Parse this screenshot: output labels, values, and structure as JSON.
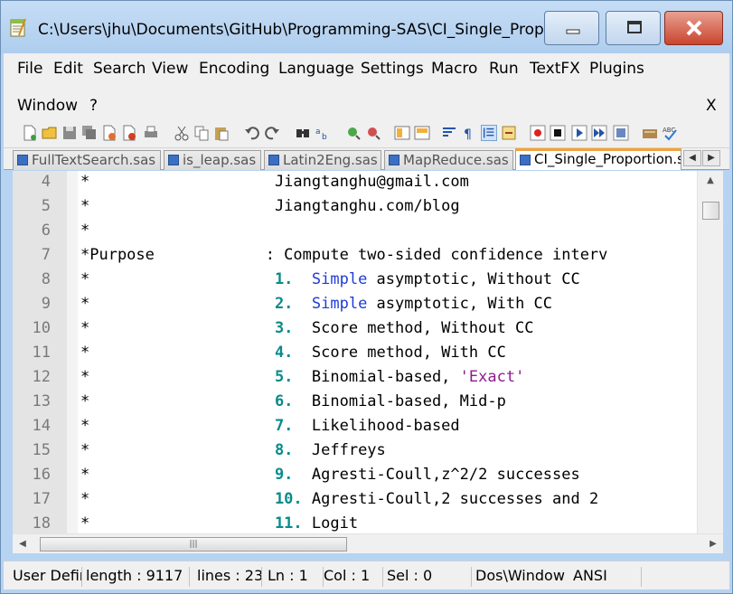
{
  "window": {
    "title": "C:\\Users\\jhu\\Documents\\GitHub\\Programming-SAS\\CI_Single_Prop..."
  },
  "menu": {
    "items": [
      "File",
      "Edit",
      "Search",
      "View",
      "Encoding",
      "Language",
      "Settings",
      "Macro",
      "Run",
      "TextFX",
      "Plugins"
    ],
    "row2": [
      "Window",
      "?"
    ],
    "close_doc": "X"
  },
  "toolbar": {
    "icons": [
      "new-file-icon",
      "open-file-icon",
      "save-icon",
      "save-all-icon",
      "close-icon",
      "close-all-icon",
      "print-icon",
      "cut-icon",
      "copy-icon",
      "paste-icon",
      "undo-icon",
      "redo-icon",
      "find-icon",
      "replace-icon",
      "zoom-in-icon",
      "zoom-out-icon",
      "sync-vertical-icon",
      "sync-horizontal-icon",
      "word-wrap-icon",
      "show-all-chars-icon",
      "indent-guide-icon",
      "fold-icon",
      "record-macro-icon",
      "stop-record-icon",
      "play-macro-icon",
      "play-multiple-icon",
      "save-macro-icon",
      "launch-icon",
      "spellcheck-icon"
    ]
  },
  "tabs": [
    {
      "label": "FullTextSearch.sas",
      "active": false
    },
    {
      "label": "is_leap.sas",
      "active": false
    },
    {
      "label": "Latin2Eng.sas",
      "active": false
    },
    {
      "label": "MapReduce.sas",
      "active": false
    },
    {
      "label": "CI_Single_Proportion.s",
      "active": true
    }
  ],
  "editor": {
    "lines": [
      {
        "n": "4",
        "pre": "*                    ",
        "num": "",
        "kw": "",
        "rest": "Jiangtanghu@gmail.com",
        "str": "",
        "tail": ""
      },
      {
        "n": "5",
        "pre": "*                    ",
        "num": "",
        "kw": "",
        "rest": "Jiangtanghu.com/blog",
        "str": "",
        "tail": ""
      },
      {
        "n": "6",
        "pre": "*",
        "num": "",
        "kw": "",
        "rest": "",
        "str": "",
        "tail": ""
      },
      {
        "n": "7",
        "pre": "*Purpose            : ",
        "num": "",
        "kw": "",
        "rest": "Compute two-sided confidence interv",
        "str": "",
        "tail": ""
      },
      {
        "n": "8",
        "pre": "*                    ",
        "num": "1.  ",
        "kw": "Simple",
        "rest": " asymptotic, Without CC",
        "str": "",
        "tail": ""
      },
      {
        "n": "9",
        "pre": "*                    ",
        "num": "2.  ",
        "kw": "Simple",
        "rest": " asymptotic, With CC",
        "str": "",
        "tail": ""
      },
      {
        "n": "10",
        "pre": "*                    ",
        "num": "3.  ",
        "kw": "",
        "rest": "Score method, Without CC",
        "str": "",
        "tail": ""
      },
      {
        "n": "11",
        "pre": "*                    ",
        "num": "4.  ",
        "kw": "",
        "rest": "Score method, With CC",
        "str": "",
        "tail": ""
      },
      {
        "n": "12",
        "pre": "*                    ",
        "num": "5.  ",
        "kw": "",
        "rest": "Binomial-based, ",
        "str": "'Exact'",
        "tail": ""
      },
      {
        "n": "13",
        "pre": "*                    ",
        "num": "6.  ",
        "kw": "",
        "rest": "Binomial-based, Mid-p",
        "str": "",
        "tail": ""
      },
      {
        "n": "14",
        "pre": "*                    ",
        "num": "7.  ",
        "kw": "",
        "rest": "Likelihood-based",
        "str": "",
        "tail": ""
      },
      {
        "n": "15",
        "pre": "*                    ",
        "num": "8.  ",
        "kw": "",
        "rest": "Jeffreys",
        "str": "",
        "tail": ""
      },
      {
        "n": "16",
        "pre": "*                    ",
        "num": "9.  ",
        "kw": "",
        "rest": "Agresti-Coull,",
        "str": "",
        "tail": "z^2/2 successes"
      },
      {
        "n": "17",
        "pre": "*                    ",
        "num": "10. ",
        "kw": "",
        "rest": "Agresti-Coull,",
        "str": "",
        "tail": "2 successes and 2"
      },
      {
        "n": "18",
        "pre": "*                    ",
        "num": "11. ",
        "kw": "",
        "rest": "Logit",
        "str": "",
        "tail": ""
      }
    ]
  },
  "status": {
    "lang": "User Defir",
    "length": "length : 9117",
    "lines": "lines : 23(",
    "ln": "Ln : 1",
    "col": "Col : 1",
    "sel": "Sel : 0",
    "eol": "Dos\\Window",
    "enc": "ANSI"
  },
  "colors": {
    "number": "#0c8a8a",
    "keyword": "#1f3bd6",
    "string": "#8f1b8f",
    "active_tab_accent": "#f2a23c",
    "titlebar": "#b6d3f1"
  }
}
